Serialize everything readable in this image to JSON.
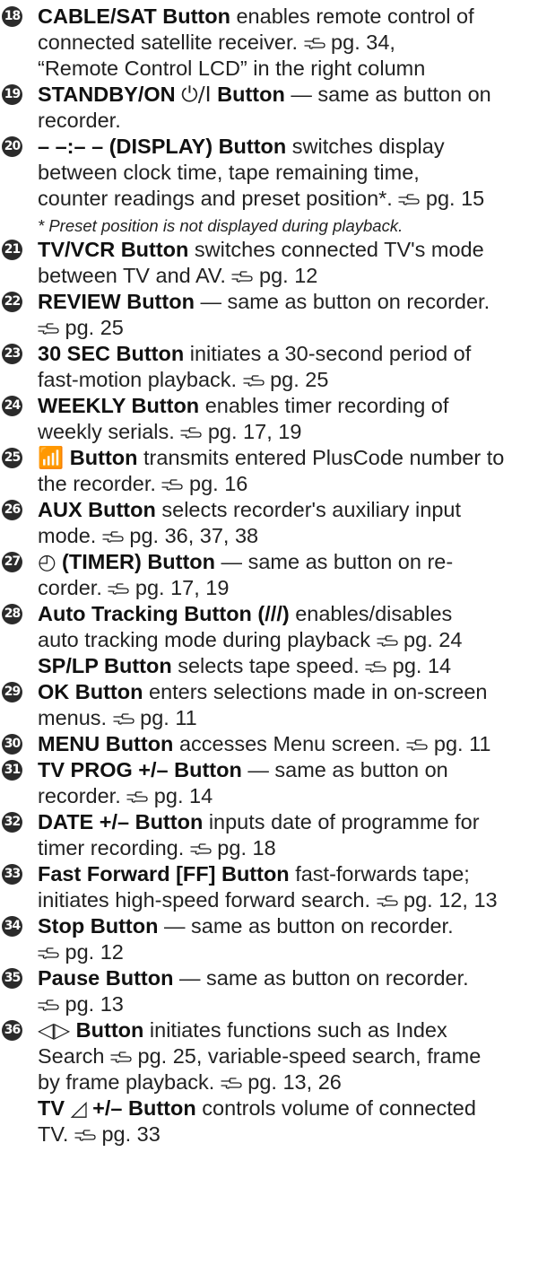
{
  "entries": [
    {
      "num": "18",
      "lines": [
        [
          {
            "b": "CABLE/SAT Button"
          },
          {
            "t": " enables remote control of"
          }
        ],
        [
          {
            "t": "connected satellite receiver.  "
          },
          {
            "ref": 1
          },
          {
            "t": " pg. 34,"
          }
        ],
        [
          {
            "t": "“Remote Control LCD” in the right column"
          }
        ]
      ]
    },
    {
      "num": "19",
      "lines": [
        [
          {
            "b": "STANDBY/ON "
          },
          {
            "sym": "⏻/I"
          },
          {
            "b": " Button"
          },
          {
            "t": " — same as button on"
          }
        ],
        [
          {
            "t": "recorder."
          }
        ]
      ]
    },
    {
      "num": "20",
      "lines": [
        [
          {
            "b": "– –:– – (DISPLAY) Button"
          },
          {
            "t": " switches display"
          }
        ],
        [
          {
            "t": "between clock time, tape remaining time,"
          }
        ],
        [
          {
            "t": "counter readings and preset position*.  "
          },
          {
            "ref": 1
          },
          {
            "t": " pg. 15"
          }
        ],
        [
          {
            "note": "* Preset position is not displayed during playback."
          }
        ]
      ]
    },
    {
      "num": "21",
      "lines": [
        [
          {
            "b": "TV/VCR Button"
          },
          {
            "t": " switches connected TV's mode"
          }
        ],
        [
          {
            "t": "between TV and AV.  "
          },
          {
            "ref": 1
          },
          {
            "t": " pg. 12"
          }
        ]
      ]
    },
    {
      "num": "22",
      "lines": [
        [
          {
            "b": "REVIEW Button"
          },
          {
            "t": " — same as button on recorder."
          }
        ],
        [
          {
            "ref": 1
          },
          {
            "t": " pg. 25"
          }
        ]
      ]
    },
    {
      "num": "23",
      "lines": [
        [
          {
            "b": "30 SEC Button"
          },
          {
            "t": " initiates a 30-second period of"
          }
        ],
        [
          {
            "t": "fast-motion playback.  "
          },
          {
            "ref": 1
          },
          {
            "t": " pg. 25"
          }
        ]
      ]
    },
    {
      "num": "24",
      "lines": [
        [
          {
            "b": "WEEKLY Button"
          },
          {
            "t": " enables timer recording of"
          }
        ],
        [
          {
            "t": "weekly serials.  "
          },
          {
            "ref": 1
          },
          {
            "t": " pg. 17, 19"
          }
        ]
      ]
    },
    {
      "num": "25",
      "lines": [
        [
          {
            "sym": "📶"
          },
          {
            "b": " Button"
          },
          {
            "t": " transmits entered PlusCode number to"
          }
        ],
        [
          {
            "t": "the recorder.  "
          },
          {
            "ref": 1
          },
          {
            "t": " pg. 16"
          }
        ]
      ]
    },
    {
      "num": "26",
      "lines": [
        [
          {
            "b": "AUX Button"
          },
          {
            "t": " selects recorder's auxiliary input"
          }
        ],
        [
          {
            "t": "mode.  "
          },
          {
            "ref": 1
          },
          {
            "t": " pg. 36, 37, 38"
          }
        ]
      ]
    },
    {
      "num": "27",
      "lines": [
        [
          {
            "sym": "◴"
          },
          {
            "b": " (TIMER) Button"
          },
          {
            "t": " — same as button on re-"
          }
        ],
        [
          {
            "t": "corder.  "
          },
          {
            "ref": 1
          },
          {
            "t": " pg. 17, 19"
          }
        ]
      ]
    },
    {
      "num": "28",
      "lines": [
        [
          {
            "b": "Auto Tracking Button ("
          },
          {
            "b": "///"
          },
          {
            "b": ")"
          },
          {
            "t": " enables/disables"
          }
        ],
        [
          {
            "t": "auto tracking mode during playback  "
          },
          {
            "ref": 1
          },
          {
            "t": " pg. 24"
          }
        ],
        [
          {
            "b": "SP/LP Button"
          },
          {
            "t": " selects tape speed.  "
          },
          {
            "ref": 1
          },
          {
            "t": " pg. 14"
          }
        ]
      ]
    },
    {
      "num": "29",
      "lines": [
        [
          {
            "b": "OK Button"
          },
          {
            "t": " enters selections made in on-screen"
          }
        ],
        [
          {
            "t": "menus.  "
          },
          {
            "ref": 1
          },
          {
            "t": " pg. 11"
          }
        ]
      ]
    },
    {
      "num": "30",
      "lines": [
        [
          {
            "b": "MENU Button"
          },
          {
            "t": " accesses Menu screen.  "
          },
          {
            "ref": 1
          },
          {
            "t": " pg. 11"
          }
        ]
      ]
    },
    {
      "num": "31",
      "lines": [
        [
          {
            "b": "TV PROG +/– Button"
          },
          {
            "t": " — same as button on"
          }
        ],
        [
          {
            "t": "recorder.  "
          },
          {
            "ref": 1
          },
          {
            "t": " pg. 14"
          }
        ]
      ]
    },
    {
      "num": "32",
      "lines": [
        [
          {
            "b": "DATE +/– Button"
          },
          {
            "t": " inputs date of programme for"
          }
        ],
        [
          {
            "t": "timer recording.  "
          },
          {
            "ref": 1
          },
          {
            "t": " pg. 18"
          }
        ]
      ]
    },
    {
      "num": "33",
      "lines": [
        [
          {
            "b": "Fast Forward [FF] Button"
          },
          {
            "t": " fast-forwards tape;"
          }
        ],
        [
          {
            "t": "initiates high-speed forward search.  "
          },
          {
            "ref": 1
          },
          {
            "t": " pg. 12, 13"
          }
        ]
      ]
    },
    {
      "num": "34",
      "lines": [
        [
          {
            "b": "Stop Button"
          },
          {
            "t": " — same as button on recorder."
          }
        ],
        [
          {
            "ref": 1
          },
          {
            "t": " pg. 12"
          }
        ]
      ]
    },
    {
      "num": "35",
      "lines": [
        [
          {
            "b": "Pause Button"
          },
          {
            "t": " — same as button on recorder."
          }
        ],
        [
          {
            "ref": 1
          },
          {
            "t": " pg. 13"
          }
        ]
      ]
    },
    {
      "num": "36",
      "lines": [
        [
          {
            "sym": "◁▷"
          },
          {
            "b": " Button"
          },
          {
            "t": " initiates functions such as Index"
          }
        ],
        [
          {
            "t": "Search  "
          },
          {
            "ref": 1
          },
          {
            "t": " pg. 25, variable-speed search, frame"
          }
        ],
        [
          {
            "t": "by frame playback.  "
          },
          {
            "ref": 1
          },
          {
            "t": " pg. 13, 26"
          }
        ],
        [
          {
            "b": "TV "
          },
          {
            "sym": "◿"
          },
          {
            "b": " +/– Button"
          },
          {
            "t": " controls volume of connected"
          }
        ],
        [
          {
            "t": "TV.  "
          },
          {
            "ref": 1
          },
          {
            "t": " pg. 33"
          }
        ]
      ]
    }
  ]
}
